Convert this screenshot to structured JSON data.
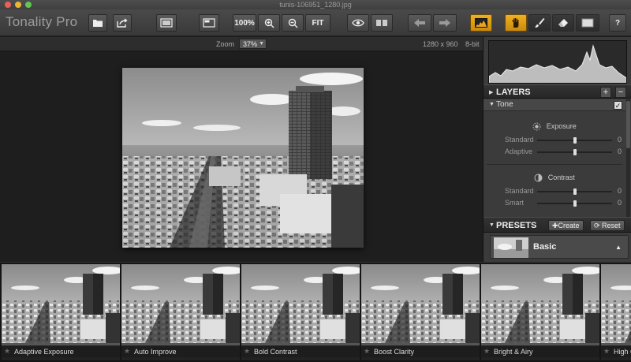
{
  "window": {
    "title": "tunis-106951_1280.jpg"
  },
  "toolbar": {
    "app_name": "Tonality Pro",
    "zoom_100": "100%",
    "fit_label": "FIT",
    "help_label": "?",
    "icons": {
      "open": "folder-icon",
      "export": "share-icon",
      "compare": "compare-view-icon",
      "zoom_in": "zoom-in-icon",
      "zoom_out": "zoom-out-icon",
      "preview": "eye-icon",
      "split": "split-view-icon",
      "undo": "undo-arrow-icon",
      "redo": "redo-arrow-icon",
      "histogram": "histogram-icon",
      "hand": "hand-tool-icon",
      "brush": "brush-tool-icon",
      "eraser": "eraser-tool-icon",
      "mask": "mask-view-icon"
    },
    "accent_color": "#e9a41a"
  },
  "infobar": {
    "zoom_label": "Zoom",
    "zoom_value": "37%",
    "dimensions": "1280 x 960",
    "bit_depth": "8-bit"
  },
  "layers": {
    "title": "LAYERS",
    "add_label": "+",
    "remove_label": "−",
    "tone": {
      "label": "Tone",
      "checked": "✓",
      "groups": [
        {
          "title": "Exposure",
          "icon": "exposure-icon",
          "sliders": [
            {
              "name": "Standard",
              "value": "0",
              "position": 0.5
            },
            {
              "name": "Adaptive",
              "value": "0",
              "position": 0.5
            }
          ]
        },
        {
          "title": "Contrast",
          "icon": "contrast-icon",
          "sliders": [
            {
              "name": "Standard",
              "value": "0",
              "position": 0.5
            },
            {
              "name": "Smart",
              "value": "0",
              "position": 0.5
            }
          ]
        }
      ]
    }
  },
  "presets": {
    "title": "PRESETS",
    "create_label": "✚Create",
    "reset_label": "⟳ Reset",
    "selected": "Basic"
  },
  "filmstrip": {
    "items": [
      {
        "name": "Adaptive Exposure"
      },
      {
        "name": "Auto Improve"
      },
      {
        "name": "Bold Contrast"
      },
      {
        "name": "Boost Clarity"
      },
      {
        "name": "Bright & Airy"
      },
      {
        "name": "High C"
      }
    ]
  }
}
